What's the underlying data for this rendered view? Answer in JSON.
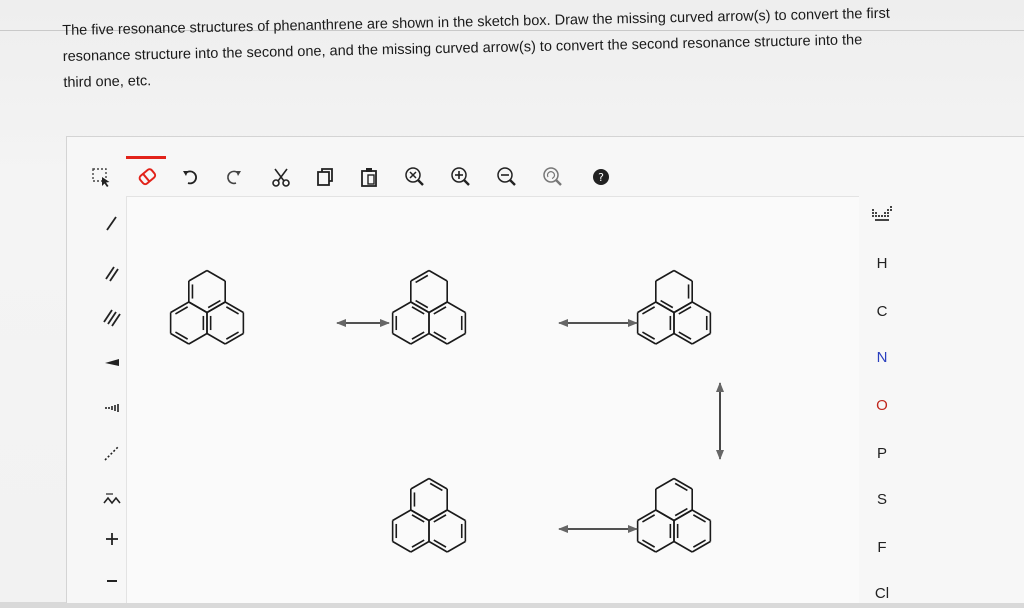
{
  "question": {
    "line1": "The five resonance structures of phenanthrene are shown in the sketch box. Draw the missing curved arrow(s) to convert the first",
    "line2": "resonance structure into the second one, and the missing curved arrow(s) to convert the second resonance structure into the",
    "line3": "third one, etc."
  },
  "toolbar": {
    "tools": [
      {
        "name": "select-tool",
        "icon": "selection-icon"
      },
      {
        "name": "erase-tool",
        "icon": "eraser-icon",
        "active": true
      },
      {
        "name": "undo-button",
        "icon": "undo-icon"
      },
      {
        "name": "redo-button",
        "icon": "redo-icon"
      },
      {
        "name": "cut-button",
        "icon": "scissors-icon"
      },
      {
        "name": "copy-button",
        "icon": "copy-icon"
      },
      {
        "name": "paste-button",
        "icon": "paste-icon"
      },
      {
        "name": "clear-button",
        "icon": "clear-zoom-icon"
      },
      {
        "name": "zoom-in-button",
        "icon": "zoom-in-icon"
      },
      {
        "name": "zoom-out-button",
        "icon": "zoom-out-icon"
      },
      {
        "name": "zoom-reset-button",
        "icon": "zoom-reset-icon"
      },
      {
        "name": "help-button",
        "icon": "help-icon"
      }
    ],
    "active_color": "#e2231a"
  },
  "left_tools": [
    "single-bond-icon",
    "double-bond-icon",
    "triple-bond-icon",
    "wedge-bond-icon",
    "hash-bond-icon",
    "dashed-bond-icon",
    "chain-icon",
    "positive-charge-icon",
    "negative-charge-icon"
  ],
  "elements": {
    "periodic_icon": "periodic-table-icon",
    "list": [
      "H",
      "C",
      "N",
      "O",
      "P",
      "S",
      "F",
      "Cl"
    ]
  },
  "canvas": {
    "structures": [
      {
        "name": "resonance-structure-1",
        "variant": "a"
      },
      {
        "name": "resonance-structure-2",
        "variant": "b"
      },
      {
        "name": "resonance-structure-3",
        "variant": "c"
      },
      {
        "name": "resonance-structure-4",
        "variant": "d"
      },
      {
        "name": "resonance-structure-5",
        "variant": "e"
      }
    ],
    "arrows": [
      "resonance-arrow-1-2",
      "resonance-arrow-2-3",
      "resonance-arrow-3-4",
      "resonance-arrow-4-5"
    ]
  }
}
